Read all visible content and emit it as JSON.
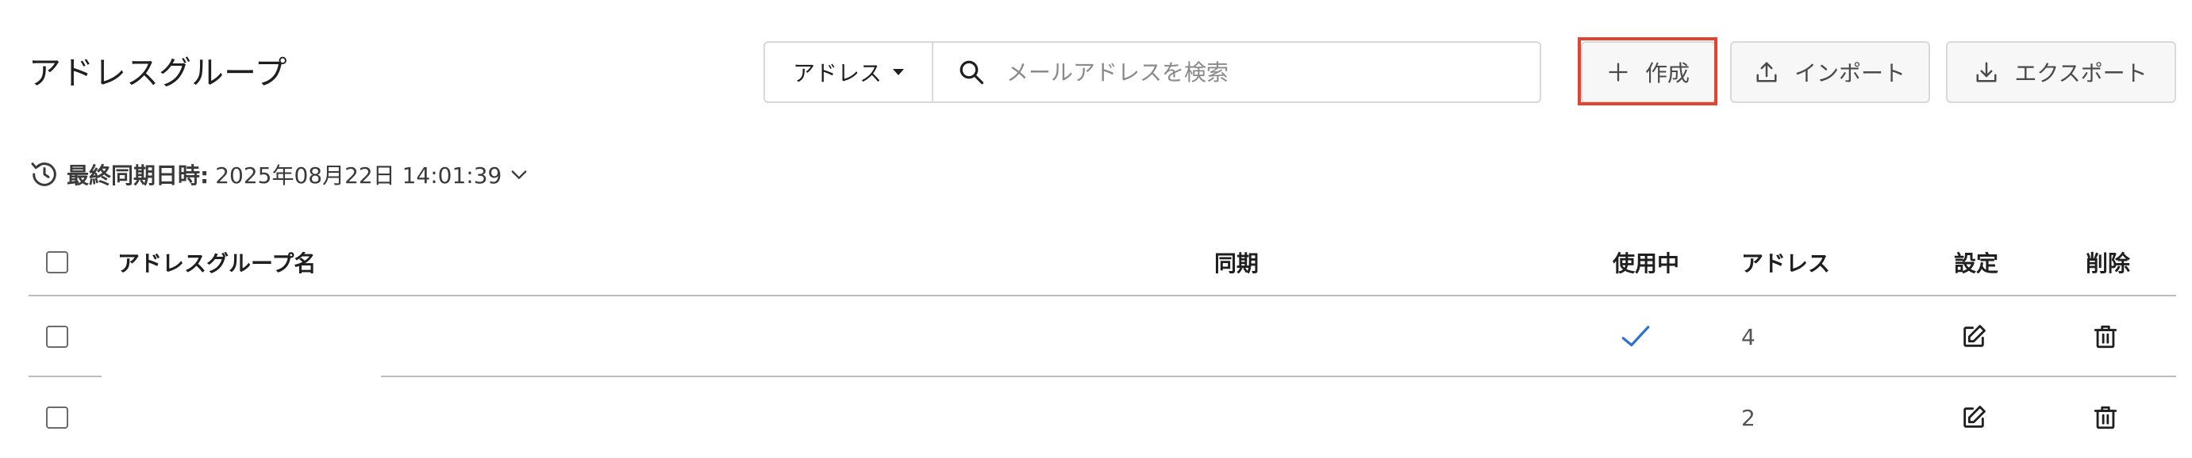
{
  "header": {
    "title": "アドレスグループ",
    "search": {
      "scope_label": "アドレス",
      "placeholder": "メールアドレスを検索",
      "value": ""
    },
    "buttons": {
      "create": "作成",
      "import": "インポート",
      "export": "エクスポート"
    },
    "highlight_color": "#e0452f"
  },
  "sync": {
    "label": "最終同期日時:",
    "value": "2025年08月22日 14:01:39"
  },
  "table": {
    "columns": {
      "name": "アドレスグループ名",
      "sync": "同期",
      "in_use": "使用中",
      "address": "アドレス",
      "settings": "設定",
      "delete": "削除"
    },
    "rows": [
      {
        "name": "",
        "sync": "",
        "in_use": true,
        "address": "4"
      },
      {
        "name": "",
        "sync": "",
        "in_use": false,
        "address": "2"
      }
    ]
  },
  "colors": {
    "check_mark": "#2f6fd6",
    "border": "#d9d9d9",
    "divider": "#bdbdbd"
  },
  "icons": {
    "search": "search-icon",
    "scope_dropdown": "caret-down-icon",
    "create": "plus-icon",
    "import": "upload-icon",
    "export": "download-icon",
    "sync": "history-icon",
    "sync_expand": "chevron-down-icon",
    "in_use": "check-icon",
    "settings": "edit-icon",
    "delete": "trash-icon"
  }
}
